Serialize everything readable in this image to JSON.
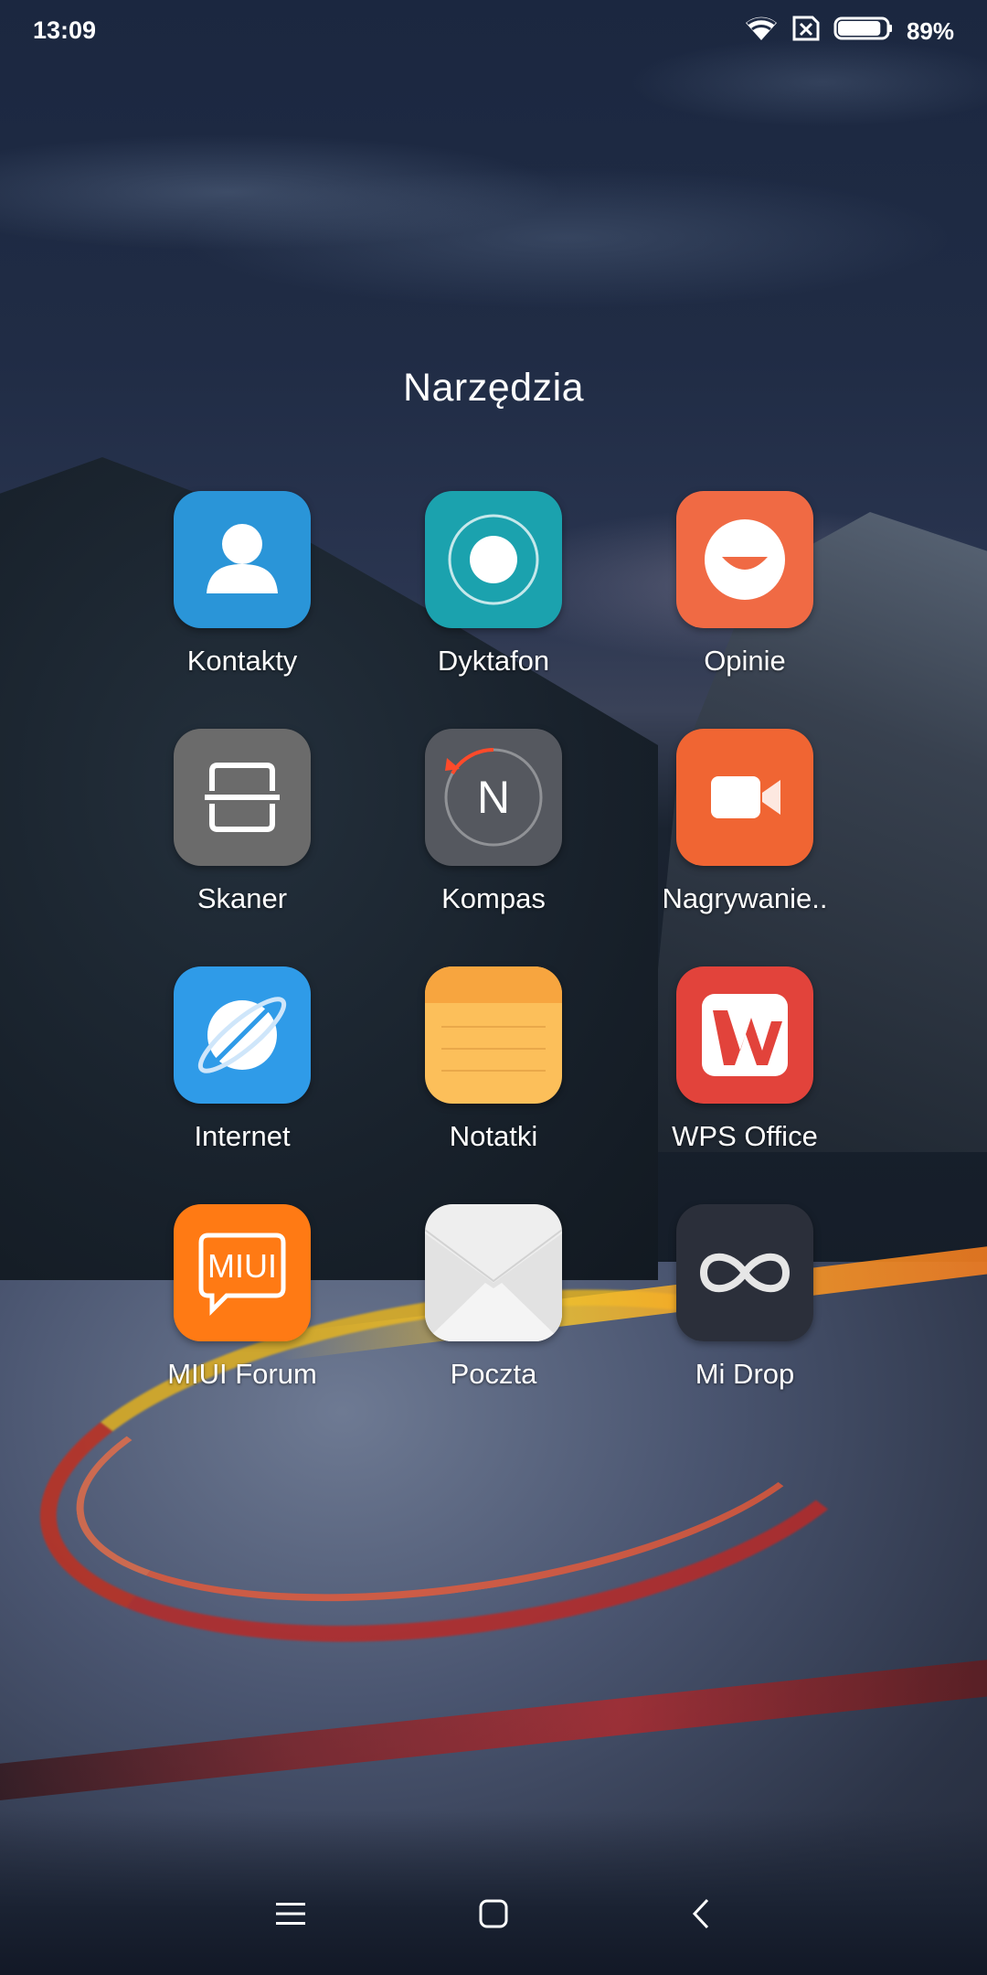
{
  "status_bar": {
    "time": "13:09",
    "battery_percent": "89%",
    "battery_level": 0.89,
    "icons": [
      "wifi-icon",
      "no-sim-icon",
      "battery-icon"
    ]
  },
  "folder": {
    "title": "Narzędzia",
    "apps": [
      {
        "label": "Kontakty",
        "icon": "contacts-icon",
        "color": "#2a95d8"
      },
      {
        "label": "Dyktafon",
        "icon": "recorder-icon",
        "color": "#1ba2ae"
      },
      {
        "label": "Opinie",
        "icon": "feedback-icon",
        "color": "#f06a44"
      },
      {
        "label": "Skaner",
        "icon": "scanner-icon",
        "color": "#6b6b6b"
      },
      {
        "label": "Kompas",
        "icon": "compass-icon",
        "color": "#55585f"
      },
      {
        "label": "Nagrywanie..",
        "icon": "screen-recorder-icon",
        "color": "#f06533"
      },
      {
        "label": "Internet",
        "icon": "browser-icon",
        "color": "#2f9be8"
      },
      {
        "label": "Notatki",
        "icon": "notes-icon",
        "color": "#fcbf5a"
      },
      {
        "label": "WPS Office",
        "icon": "wps-office-icon",
        "color": "#e2433b"
      },
      {
        "label": "MIUI Forum",
        "icon": "miui-forum-icon",
        "color": "#ff7a14"
      },
      {
        "label": "Poczta",
        "icon": "mail-icon",
        "color": "#eeeeee"
      },
      {
        "label": "Mi Drop",
        "icon": "mi-drop-icon",
        "color": "#2b2f3a"
      }
    ],
    "miui_badge": "MIUI",
    "compass_letter": "N"
  },
  "nav_bar": {
    "buttons": [
      "menu-icon",
      "home-icon",
      "back-icon"
    ]
  }
}
